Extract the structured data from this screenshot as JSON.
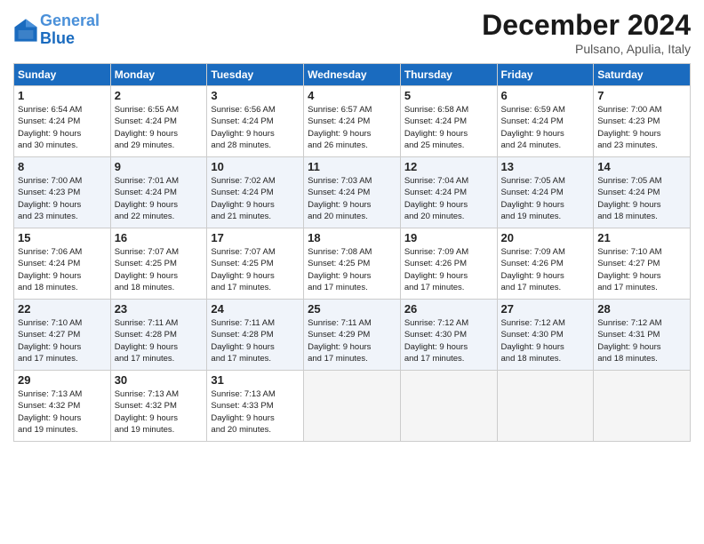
{
  "header": {
    "logo_line1": "General",
    "logo_line2": "Blue",
    "month": "December 2024",
    "location": "Pulsano, Apulia, Italy"
  },
  "days_of_week": [
    "Sunday",
    "Monday",
    "Tuesday",
    "Wednesday",
    "Thursday",
    "Friday",
    "Saturday"
  ],
  "weeks": [
    [
      {
        "num": "1",
        "info": "Sunrise: 6:54 AM\nSunset: 4:24 PM\nDaylight: 9 hours\nand 30 minutes."
      },
      {
        "num": "2",
        "info": "Sunrise: 6:55 AM\nSunset: 4:24 PM\nDaylight: 9 hours\nand 29 minutes."
      },
      {
        "num": "3",
        "info": "Sunrise: 6:56 AM\nSunset: 4:24 PM\nDaylight: 9 hours\nand 28 minutes."
      },
      {
        "num": "4",
        "info": "Sunrise: 6:57 AM\nSunset: 4:24 PM\nDaylight: 9 hours\nand 26 minutes."
      },
      {
        "num": "5",
        "info": "Sunrise: 6:58 AM\nSunset: 4:24 PM\nDaylight: 9 hours\nand 25 minutes."
      },
      {
        "num": "6",
        "info": "Sunrise: 6:59 AM\nSunset: 4:24 PM\nDaylight: 9 hours\nand 24 minutes."
      },
      {
        "num": "7",
        "info": "Sunrise: 7:00 AM\nSunset: 4:23 PM\nDaylight: 9 hours\nand 23 minutes."
      }
    ],
    [
      {
        "num": "8",
        "info": "Sunrise: 7:00 AM\nSunset: 4:23 PM\nDaylight: 9 hours\nand 23 minutes."
      },
      {
        "num": "9",
        "info": "Sunrise: 7:01 AM\nSunset: 4:24 PM\nDaylight: 9 hours\nand 22 minutes."
      },
      {
        "num": "10",
        "info": "Sunrise: 7:02 AM\nSunset: 4:24 PM\nDaylight: 9 hours\nand 21 minutes."
      },
      {
        "num": "11",
        "info": "Sunrise: 7:03 AM\nSunset: 4:24 PM\nDaylight: 9 hours\nand 20 minutes."
      },
      {
        "num": "12",
        "info": "Sunrise: 7:04 AM\nSunset: 4:24 PM\nDaylight: 9 hours\nand 20 minutes."
      },
      {
        "num": "13",
        "info": "Sunrise: 7:05 AM\nSunset: 4:24 PM\nDaylight: 9 hours\nand 19 minutes."
      },
      {
        "num": "14",
        "info": "Sunrise: 7:05 AM\nSunset: 4:24 PM\nDaylight: 9 hours\nand 18 minutes."
      }
    ],
    [
      {
        "num": "15",
        "info": "Sunrise: 7:06 AM\nSunset: 4:24 PM\nDaylight: 9 hours\nand 18 minutes."
      },
      {
        "num": "16",
        "info": "Sunrise: 7:07 AM\nSunset: 4:25 PM\nDaylight: 9 hours\nand 18 minutes."
      },
      {
        "num": "17",
        "info": "Sunrise: 7:07 AM\nSunset: 4:25 PM\nDaylight: 9 hours\nand 17 minutes."
      },
      {
        "num": "18",
        "info": "Sunrise: 7:08 AM\nSunset: 4:25 PM\nDaylight: 9 hours\nand 17 minutes."
      },
      {
        "num": "19",
        "info": "Sunrise: 7:09 AM\nSunset: 4:26 PM\nDaylight: 9 hours\nand 17 minutes."
      },
      {
        "num": "20",
        "info": "Sunrise: 7:09 AM\nSunset: 4:26 PM\nDaylight: 9 hours\nand 17 minutes."
      },
      {
        "num": "21",
        "info": "Sunrise: 7:10 AM\nSunset: 4:27 PM\nDaylight: 9 hours\nand 17 minutes."
      }
    ],
    [
      {
        "num": "22",
        "info": "Sunrise: 7:10 AM\nSunset: 4:27 PM\nDaylight: 9 hours\nand 17 minutes."
      },
      {
        "num": "23",
        "info": "Sunrise: 7:11 AM\nSunset: 4:28 PM\nDaylight: 9 hours\nand 17 minutes."
      },
      {
        "num": "24",
        "info": "Sunrise: 7:11 AM\nSunset: 4:28 PM\nDaylight: 9 hours\nand 17 minutes."
      },
      {
        "num": "25",
        "info": "Sunrise: 7:11 AM\nSunset: 4:29 PM\nDaylight: 9 hours\nand 17 minutes."
      },
      {
        "num": "26",
        "info": "Sunrise: 7:12 AM\nSunset: 4:30 PM\nDaylight: 9 hours\nand 17 minutes."
      },
      {
        "num": "27",
        "info": "Sunrise: 7:12 AM\nSunset: 4:30 PM\nDaylight: 9 hours\nand 18 minutes."
      },
      {
        "num": "28",
        "info": "Sunrise: 7:12 AM\nSunset: 4:31 PM\nDaylight: 9 hours\nand 18 minutes."
      }
    ],
    [
      {
        "num": "29",
        "info": "Sunrise: 7:13 AM\nSunset: 4:32 PM\nDaylight: 9 hours\nand 19 minutes."
      },
      {
        "num": "30",
        "info": "Sunrise: 7:13 AM\nSunset: 4:32 PM\nDaylight: 9 hours\nand 19 minutes."
      },
      {
        "num": "31",
        "info": "Sunrise: 7:13 AM\nSunset: 4:33 PM\nDaylight: 9 hours\nand 20 minutes."
      },
      null,
      null,
      null,
      null
    ]
  ]
}
